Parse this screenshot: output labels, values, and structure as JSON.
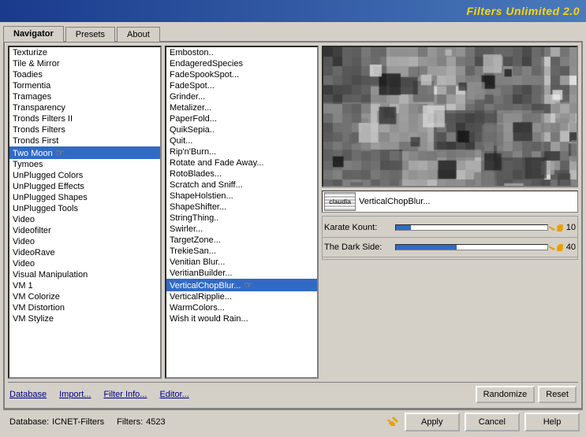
{
  "titleBar": {
    "text": "Filters Unlimited 2.0"
  },
  "tabs": [
    {
      "id": "navigator",
      "label": "Navigator",
      "active": true
    },
    {
      "id": "presets",
      "label": "Presets",
      "active": false
    },
    {
      "id": "about",
      "label": "About",
      "active": false
    }
  ],
  "leftList": {
    "items": [
      "Texturize",
      "Tile & Mirror",
      "Toadies",
      "Tormentia",
      "Tramages",
      "Transparency",
      "Tronds Filters II",
      "Tronds Filters",
      "Tronds First",
      "Two Moon",
      "Tymoes",
      "UnPlugged Colors",
      "UnPlugged Effects",
      "UnPlugged Shapes",
      "UnPlugged Tools",
      "Video",
      "Videofilter",
      "Video",
      "VideoRave",
      "Video",
      "Visual Manipulation",
      "VM 1",
      "VM Colorize",
      "VM Distortion",
      "VM Stylize"
    ],
    "selectedIndex": 9,
    "highlightedText": "Two Moon"
  },
  "middleList": {
    "items": [
      "Emboston..",
      "EndageredSpecies",
      "FadeSpookSpot...",
      "FadeSpot...",
      "Grinder...",
      "Metalizer...",
      "PaperFold...",
      "QuikSepia..",
      "Quit...",
      "Rip'n'Burn...",
      "Rotate and Fade Away...",
      "RotoBlades...",
      "Scratch and Sniff...",
      "ShapeHolstien...",
      "ShapeShifter...",
      "StringThing..",
      "Swirler...",
      "TargetZone...",
      "TrekieSan...",
      "Venitian Blur...",
      "VeritianBuilder...",
      "VerticalChopBlur...",
      "VerticalRipplie...",
      "WarmColors...",
      "Wish it would Rain..."
    ],
    "selectedIndex": 21,
    "selectedText": "VerticalChopBlur..."
  },
  "filterDisplay": {
    "name": "VerticalChopBlur...",
    "iconLabel": "claudia"
  },
  "sliders": [
    {
      "label": "Karate Kount:",
      "value": 10,
      "max": 100,
      "fillPercent": 10
    },
    {
      "label": "The Dark Side:",
      "value": 40,
      "max": 100,
      "fillPercent": 40
    }
  ],
  "toolbar": {
    "database": "Database",
    "import": "Import...",
    "filterInfo": "Filter Info...",
    "editor": "Editor...",
    "randomize": "Randomize",
    "reset": "Reset"
  },
  "statusBar": {
    "databaseLabel": "Database:",
    "databaseValue": "ICNET-Filters",
    "filtersLabel": "Filters:",
    "filtersValue": "4523"
  },
  "actionButtons": {
    "apply": "Apply",
    "cancel": "Cancel",
    "help": "Help"
  }
}
